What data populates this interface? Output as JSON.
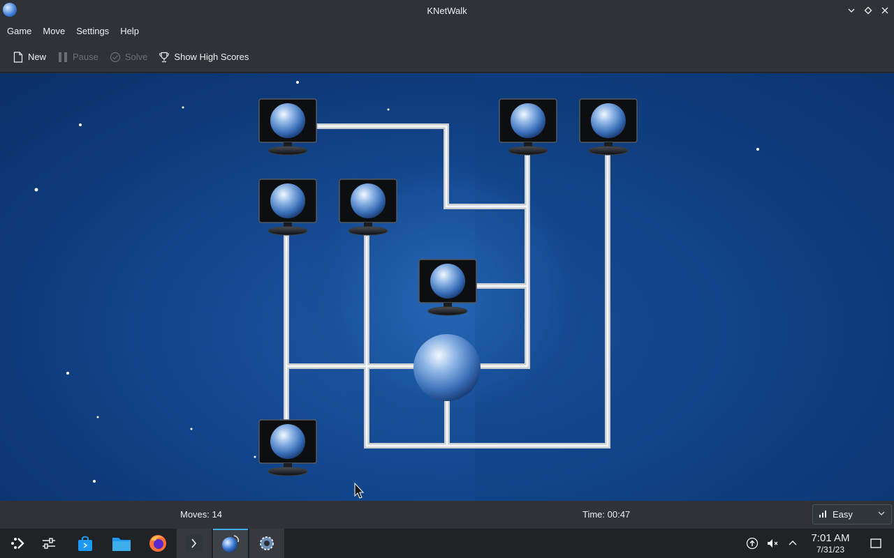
{
  "window": {
    "title": "KNetWalk"
  },
  "menu": {
    "items": [
      "Game",
      "Move",
      "Settings",
      "Help"
    ]
  },
  "toolbar": {
    "new_label": "New",
    "pause_label": "Pause",
    "solve_label": "Solve",
    "high_scores_label": "Show High Scores"
  },
  "status": {
    "moves": "Moves: 14",
    "time": "Time: 00:47",
    "difficulty": "Easy"
  },
  "taskbar": {
    "time": "7:01 AM",
    "date": "7/31/23"
  },
  "colors": {
    "accent": "#3daee9",
    "board": "#154a92",
    "cable": "#d8dde2"
  }
}
